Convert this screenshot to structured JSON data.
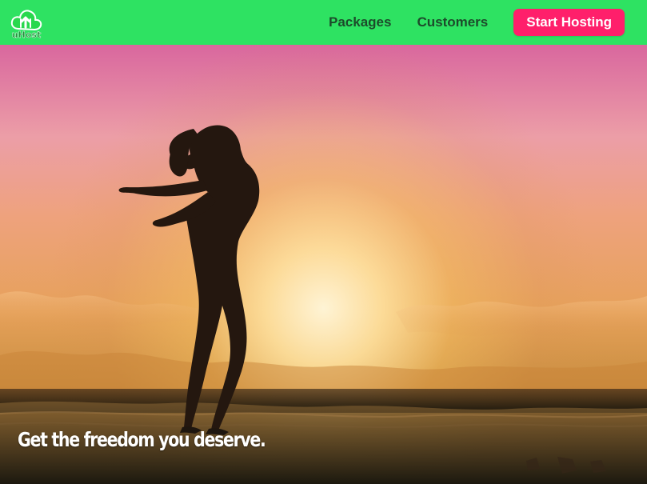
{
  "brand": {
    "logo_label": "uHost",
    "logo_icon": "cloud-upload-logo-icon"
  },
  "navigation": {
    "links": [
      {
        "label": "Packages"
      },
      {
        "label": "Customers"
      }
    ],
    "cta_label": "Start Hosting"
  },
  "hero": {
    "headline": "Get the freedom you deserve.",
    "image_name": "woman-silhouette-at-sunset-beach-image"
  },
  "colors": {
    "nav_background": "#2ee262",
    "nav_text": "#1d4a2b",
    "cta_background": "#ff1f6b",
    "cta_text": "#ffffff",
    "hero_text": "#ffffff"
  }
}
